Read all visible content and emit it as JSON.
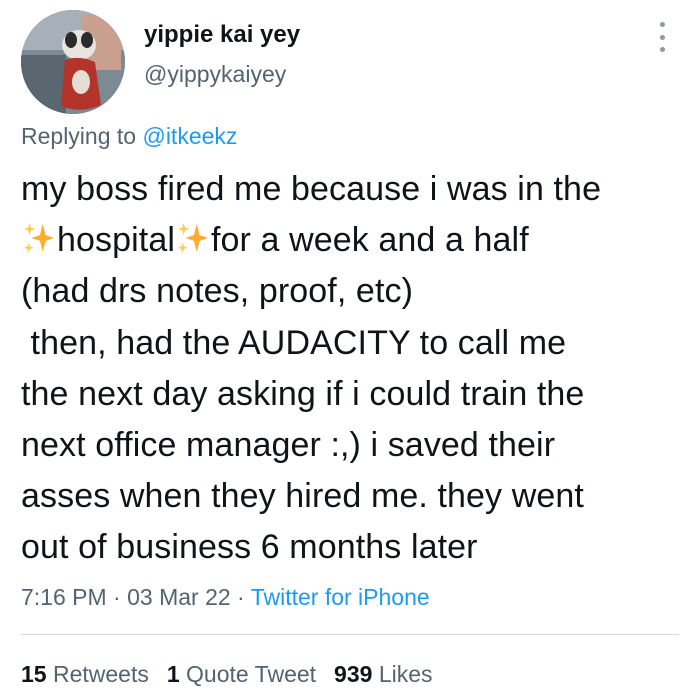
{
  "user": {
    "display_name": "yippie kai yey",
    "handle": "@yippykaiyey"
  },
  "reply": {
    "prefix": "Replying to",
    "mention": "@itkeekz"
  },
  "tweet": {
    "lines": [
      "my boss fired me because i was in the",
      "hospital",
      "for a week and a half",
      "(had drs notes, proof, etc)",
      " then, had the AUDACITY to call me",
      "the next day asking if i could train the",
      "next office manager :,) i saved their",
      "asses when they hired me. they went",
      "out of business 6 months later"
    ],
    "emoji": "sparkles-icon"
  },
  "meta": {
    "time": "7:16 PM",
    "separator": " · ",
    "date": "03 Mar 22",
    "source": "Twitter for iPhone"
  },
  "stats": {
    "retweets_count": "15",
    "retweets_label": "Retweets",
    "quotes_count": "1",
    "quotes_label": "Quote Tweet",
    "likes_count": "939",
    "likes_label": "Likes"
  },
  "colors": {
    "text": "#0f1419",
    "secondary": "#536471",
    "link": "#1d9bf0",
    "divider": "#cfd9de"
  }
}
